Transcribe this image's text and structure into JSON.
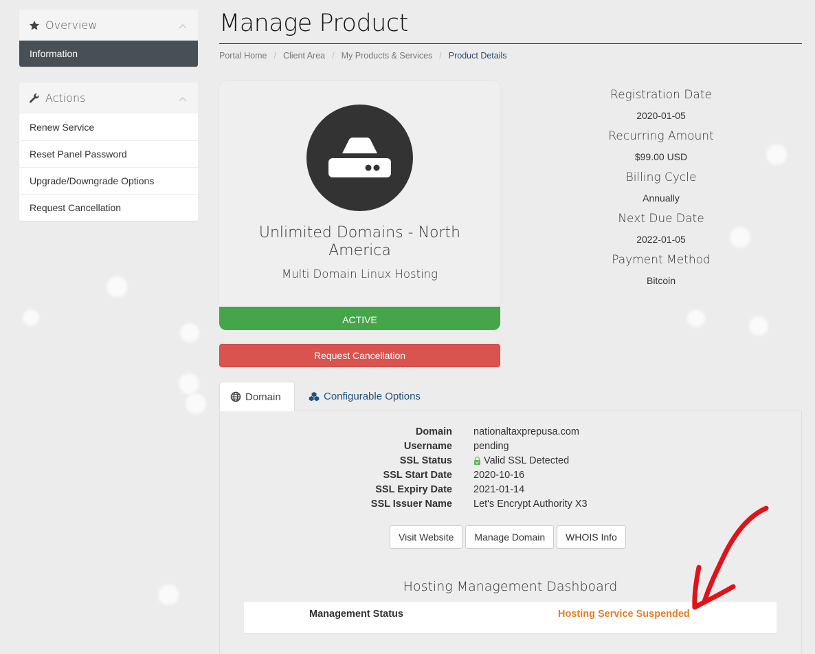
{
  "sidebar": {
    "overview": {
      "title": "Overview",
      "icon": "star-icon",
      "items": [
        {
          "label": "Information",
          "active": true
        }
      ]
    },
    "actions": {
      "title": "Actions",
      "icon": "wrench-icon",
      "items": [
        {
          "label": "Renew Service"
        },
        {
          "label": "Reset Panel Password"
        },
        {
          "label": "Upgrade/Downgrade Options"
        },
        {
          "label": "Request Cancellation"
        }
      ]
    }
  },
  "header": {
    "title": "Manage Product",
    "breadcrumb": [
      "Portal Home",
      "Client Area",
      "My Products & Services",
      "Product Details"
    ]
  },
  "product": {
    "icon": "hdd-icon",
    "name": "Unlimited Domains - North America",
    "group": "Multi Domain Linux Hosting",
    "status": "ACTIVE",
    "cancel_label": "Request Cancellation",
    "colors": {
      "status": "#45a549",
      "cancel": "#d9534f"
    }
  },
  "billing": [
    {
      "label": "Registration Date",
      "value": "2020-01-05"
    },
    {
      "label": "Recurring Amount",
      "value": "$99.00 USD"
    },
    {
      "label": "Billing Cycle",
      "value": "Annually"
    },
    {
      "label": "Next Due Date",
      "value": "2022-01-05"
    },
    {
      "label": "Payment Method",
      "value": "Bitcoin"
    }
  ],
  "tabs": [
    {
      "label": "Domain",
      "icon": "globe-icon",
      "active": true
    },
    {
      "label": "Configurable Options",
      "icon": "cubes-icon",
      "active": false
    }
  ],
  "domain_info": [
    {
      "key": "Domain",
      "value": "nationaltaxprepusa.com"
    },
    {
      "key": "Username",
      "value": "pending"
    },
    {
      "key": "SSL Status",
      "value": "Valid SSL Detected",
      "icon": "lock-icon"
    },
    {
      "key": "SSL Start Date",
      "value": "2020-10-16"
    },
    {
      "key": "SSL Expiry Date",
      "value": "2021-01-14"
    },
    {
      "key": "SSL Issuer Name",
      "value": "Let's Encrypt Authority X3"
    }
  ],
  "domain_buttons": [
    "Visit Website",
    "Manage Domain",
    "WHOIS Info"
  ],
  "dashboard": {
    "title": "Hosting Management Dashboard",
    "row_label": "Management Status",
    "row_value": "Hosting Service Suspended",
    "value_color": "#e67e22"
  },
  "annotation": {
    "type": "red-arrow",
    "color": "#e0121a"
  }
}
